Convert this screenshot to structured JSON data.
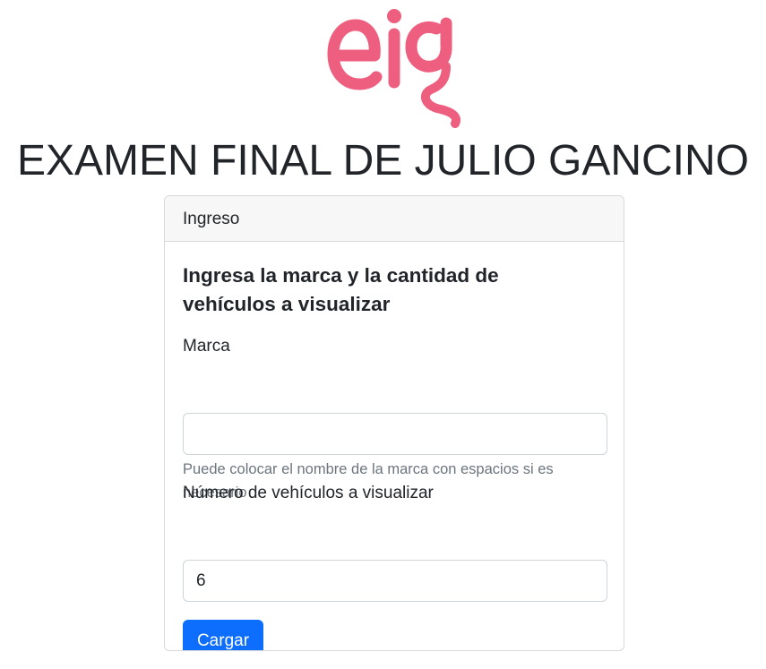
{
  "brand": {
    "logo_text": "eig",
    "logo_color": "#ee5f7f"
  },
  "header": {
    "title": "EXAMEN FINAL DE JULIO GANCINO"
  },
  "card": {
    "header": "Ingreso",
    "title": "Ingresa la marca y la cantidad de vehículos a visualizar",
    "marca": {
      "label": "Marca",
      "value": "",
      "help": "Puede colocar el nombre de la marca con espacios si es necesario"
    },
    "numero": {
      "label": "Número de vehículos a visualizar",
      "value": "6"
    },
    "submit_label": "Cargar",
    "accent_color": "#0d6efd"
  }
}
